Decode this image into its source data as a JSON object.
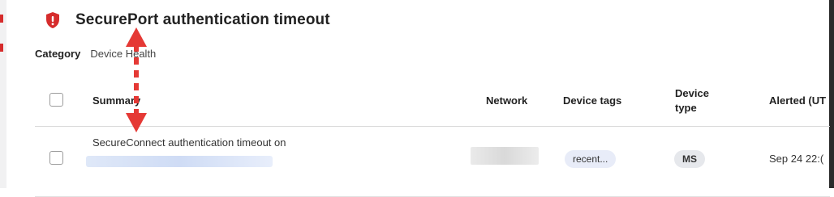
{
  "header": {
    "title": "SecurePort authentication timeout",
    "severity_icon": "alert-shield-icon",
    "severity_color": "#d62c2c"
  },
  "category": {
    "label": "Category",
    "value": "Device Health"
  },
  "table": {
    "columns": {
      "summary": "Summary",
      "network": "Network",
      "device_tags": "Device tags",
      "device_type_line1": "Device",
      "device_type_line2": "type",
      "alerted": "Alerted (UT"
    },
    "rows": [
      {
        "summary": "SecureConnect authentication timeout on",
        "device_tag": "recent...",
        "device_type": "MS",
        "alerted": "Sep 24 22:("
      }
    ]
  },
  "annotation": {
    "color": "#e53935",
    "style": "dashed-double-arrow"
  }
}
